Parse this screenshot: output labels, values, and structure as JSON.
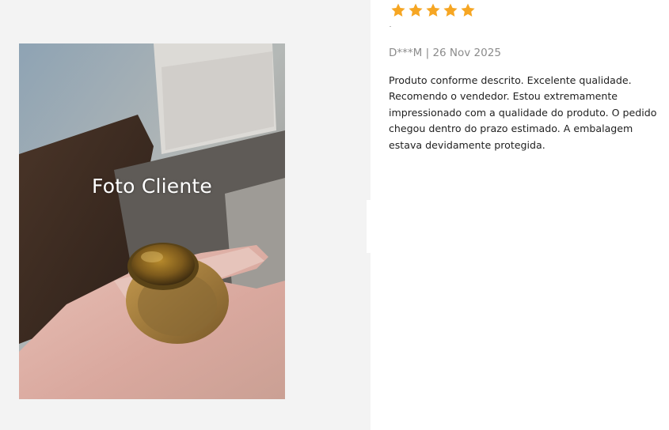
{
  "photo": {
    "caption": "Foto Cliente"
  },
  "review": {
    "rating": 5,
    "rating_max": 5,
    "star_color": "#f6a623",
    "author": "D***M",
    "separator": "|",
    "date": "26 Nov 2025",
    "text": "Produto conforme descrito. Excelente qualidade. Recomendo o vendedor. Estou extremamente impressionado com a qualidade do produto. O pedido chegou dentro do prazo estimado. A embalagem estava devidamente protegida."
  }
}
